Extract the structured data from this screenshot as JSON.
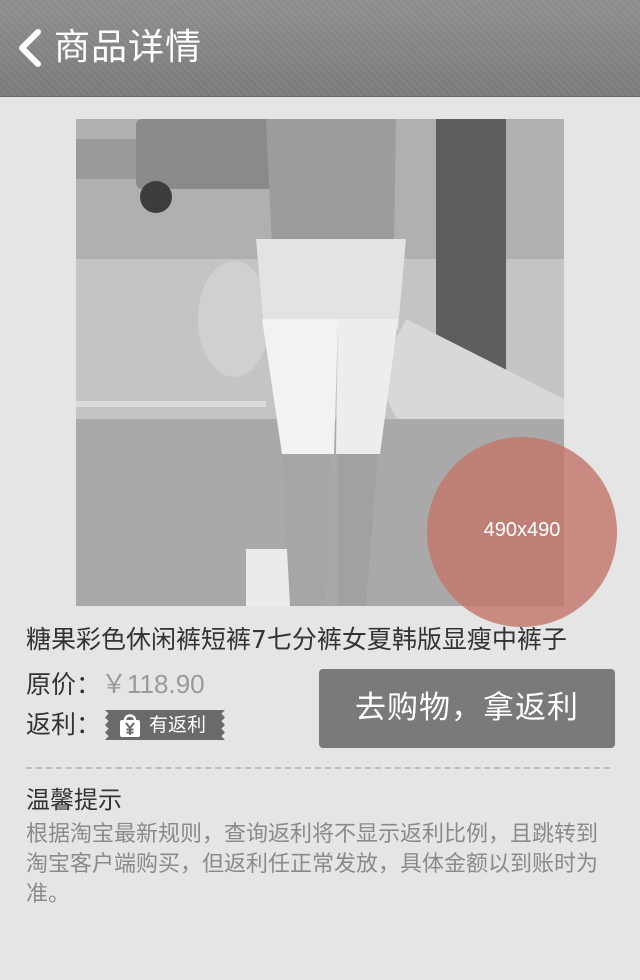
{
  "header": {
    "title": "商品详情",
    "back_icon": "chevron-left-icon"
  },
  "product": {
    "image_size_badge": "490x490",
    "title": "糖果彩色休闲裤短裤7七分裤女夏韩版显瘦中裤子",
    "price_label": "原价：",
    "price_value": "￥118.90",
    "rebate_label": "返利：",
    "rebate_badge": "有返利",
    "rebate_badge_icon": "shopping-bag-yen-icon"
  },
  "actions": {
    "buy_label": "去购物，拿返利"
  },
  "tips": {
    "title": "温馨提示",
    "body": "根据淘宝最新规则，查询返利将不显示返利比例，且跳转到淘宝客户端购买，但返利任正常发放，具体金额以到账时为准。"
  },
  "colors": {
    "header_bg": "#858585",
    "button_bg": "#7a7a7a",
    "badge_overlay": "#c2766a",
    "page_bg": "#e5e5e5"
  }
}
